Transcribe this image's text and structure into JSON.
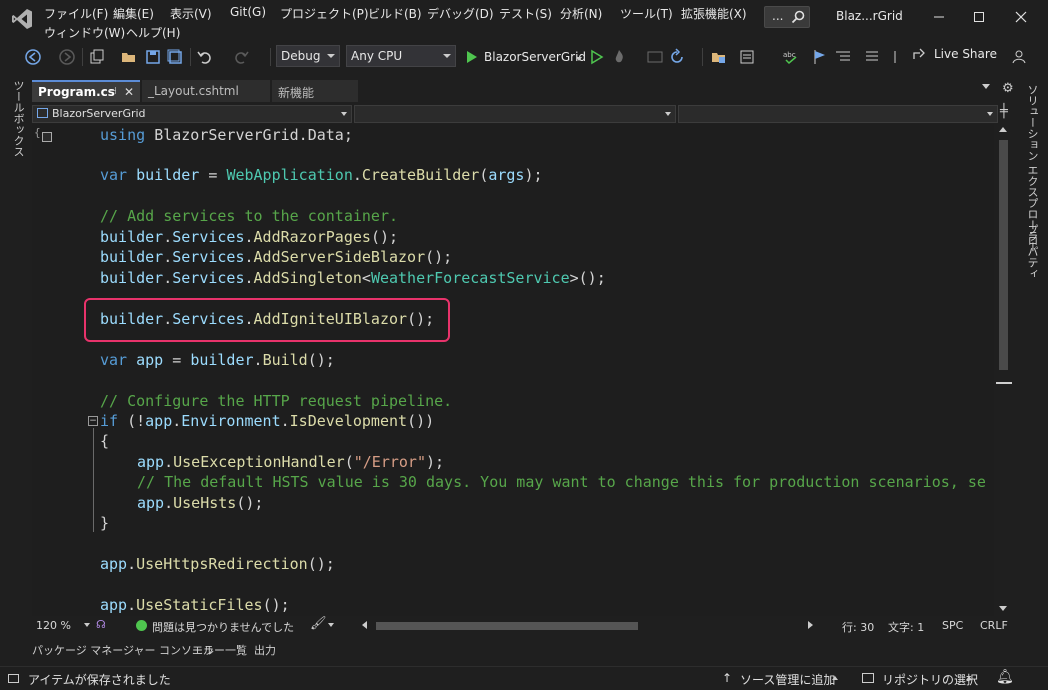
{
  "window": {
    "title": "Blaz...rGrid",
    "search_ellipsis": "..."
  },
  "menu": {
    "items": [
      "ファイル(F)",
      "編集(E)",
      "表示(V)",
      "Git(G)",
      "プロジェクト(P)",
      "ビルド(B)",
      "デバッグ(D)",
      "テスト(S)",
      "分析(N)",
      "ツール(T)",
      "拡張機能(X)",
      "ウィンドウ(W)",
      "ヘルプ(H)"
    ]
  },
  "toolbar": {
    "config": "Debug",
    "platform": "Any CPU",
    "run_target": "BlazorServerGrid",
    "live_share": "Live Share"
  },
  "side_panels": {
    "left": "ツールボックス",
    "right_top": "ソリューション エクスプローラー",
    "right_bottom": "プロパティ"
  },
  "tabs": [
    {
      "label": "Program.cs",
      "active": true
    },
    {
      "label": "_Layout.cshtml",
      "active": false
    },
    {
      "label": "新機能",
      "active": false
    }
  ],
  "nav": {
    "project": "BlazorServerGrid"
  },
  "code": {
    "l1": "using BlazorServerGrid.Data;",
    "l3": "var builder = WebApplication.CreateBuilder(args);",
    "l5": "// Add services to the container.",
    "l6": "builder.Services.AddRazorPages();",
    "l7": "builder.Services.AddServerSideBlazor();",
    "l8": "builder.Services.AddSingleton<WeatherForecastService>();",
    "l10": "builder.Services.AddIgniteUIBlazor();",
    "l12": "var app = builder.Build();",
    "l14": "// Configure the HTTP request pipeline.",
    "l15": "if (!app.Environment.IsDevelopment())",
    "l16": "{",
    "l17": "app.UseExceptionHandler(\"/Error\");",
    "l18": "// The default HSTS value is 30 days. You may want to change this for production scenarios, se",
    "l19": "app.UseHsts();",
    "l20": "}",
    "l22": "app.UseHttpsRedirection();",
    "l24": "app.UseStaticFiles();"
  },
  "editor_status": {
    "zoom": "120 %",
    "issues": "問題は見つかりませんでした",
    "line": "行: 30",
    "col": "文字: 1",
    "spc": "SPC",
    "eol": "CRLF"
  },
  "panel_tabs": [
    "パッケージ マネージャー コンソール",
    "エラー一覧",
    "出力"
  ],
  "statusbar": {
    "message": "アイテムが保存されました",
    "source_control": "ソース管理に追加",
    "repository": "リポジトリの選択"
  },
  "colors": {
    "highlight_box": "#e8336b",
    "keyword": "#569cd6",
    "variable": "#9cdcfe",
    "type": "#4ec9b0",
    "method": "#dcdcaa",
    "comment": "#57a64a",
    "string": "#d69d85"
  }
}
